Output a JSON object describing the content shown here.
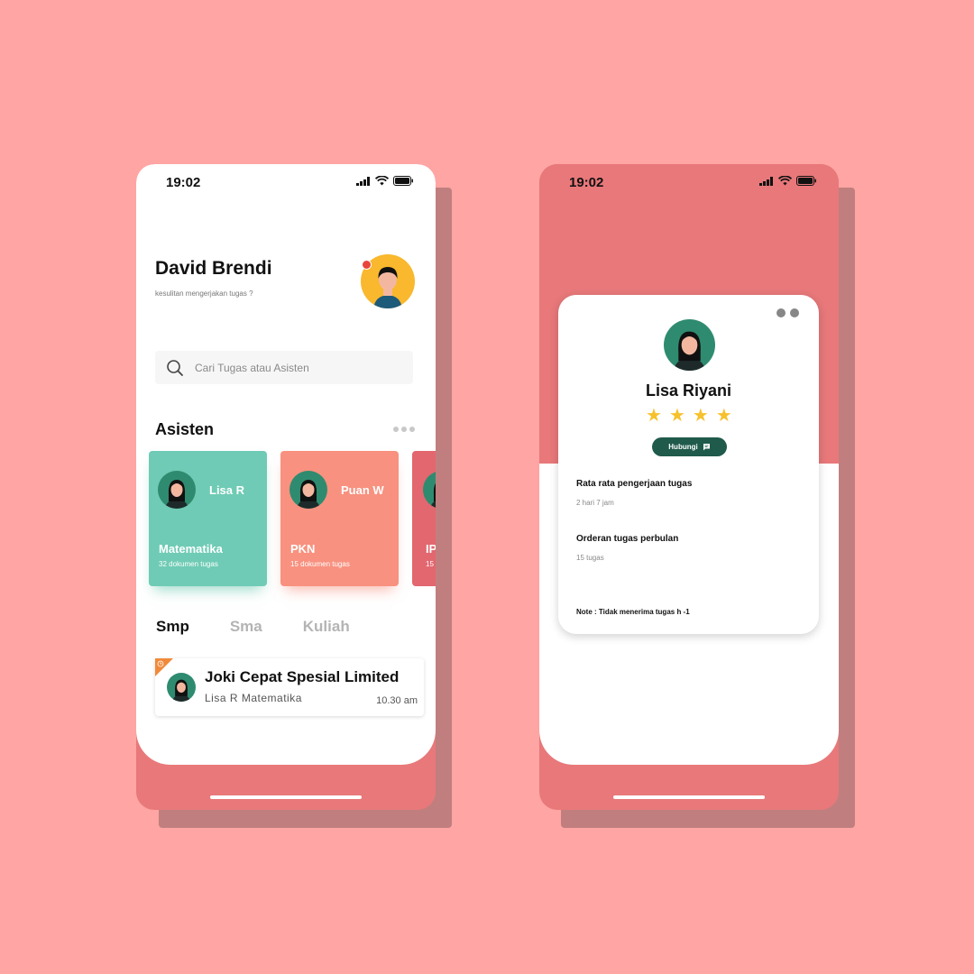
{
  "colors": {
    "background": "#ffa5a3",
    "phone_accent": "#e8787a",
    "card_green": "#6fcbb5",
    "card_salmon": "#f8917f",
    "card_rose": "#e2676f",
    "button_dark_green": "#1f5a4b",
    "star": "#f6c12c"
  },
  "phone1": {
    "status": {
      "time": "19:02"
    },
    "greeting": {
      "name": "David Brendi",
      "subtitle": "kesulitan mengerjakan tugas ?"
    },
    "search": {
      "placeholder": "Cari Tugas atau Asisten"
    },
    "assistants_section": {
      "title": "Asisten"
    },
    "assistants": [
      {
        "name": "Lisa R",
        "subject": "Matematika",
        "docs": "32 dokumen tugas"
      },
      {
        "name": "Puan W",
        "subject": "PKN",
        "docs": "15 dokumen tugas"
      },
      {
        "name": "",
        "subject": "IP",
        "docs": "15"
      }
    ],
    "tabs": [
      "Smp",
      "Sma",
      "Kuliah"
    ],
    "active_tab": "Smp",
    "task": {
      "title": "Joki Cepat Spesial Limited",
      "subtitle": "Lisa R Matematika",
      "time": "10.30 am"
    }
  },
  "phone2": {
    "status": {
      "time": "19:02"
    },
    "profile": {
      "name": "Lisa Riyani",
      "rating": 4,
      "contact_label": "Hubungi",
      "stats": [
        {
          "label": "Rata rata pengerjaan tugas",
          "value": "2 hari 7 jam"
        },
        {
          "label": "Orderan tugas perbulan",
          "value": "15 tugas"
        }
      ],
      "note": "Note : Tidak menerima tugas h -1"
    }
  }
}
